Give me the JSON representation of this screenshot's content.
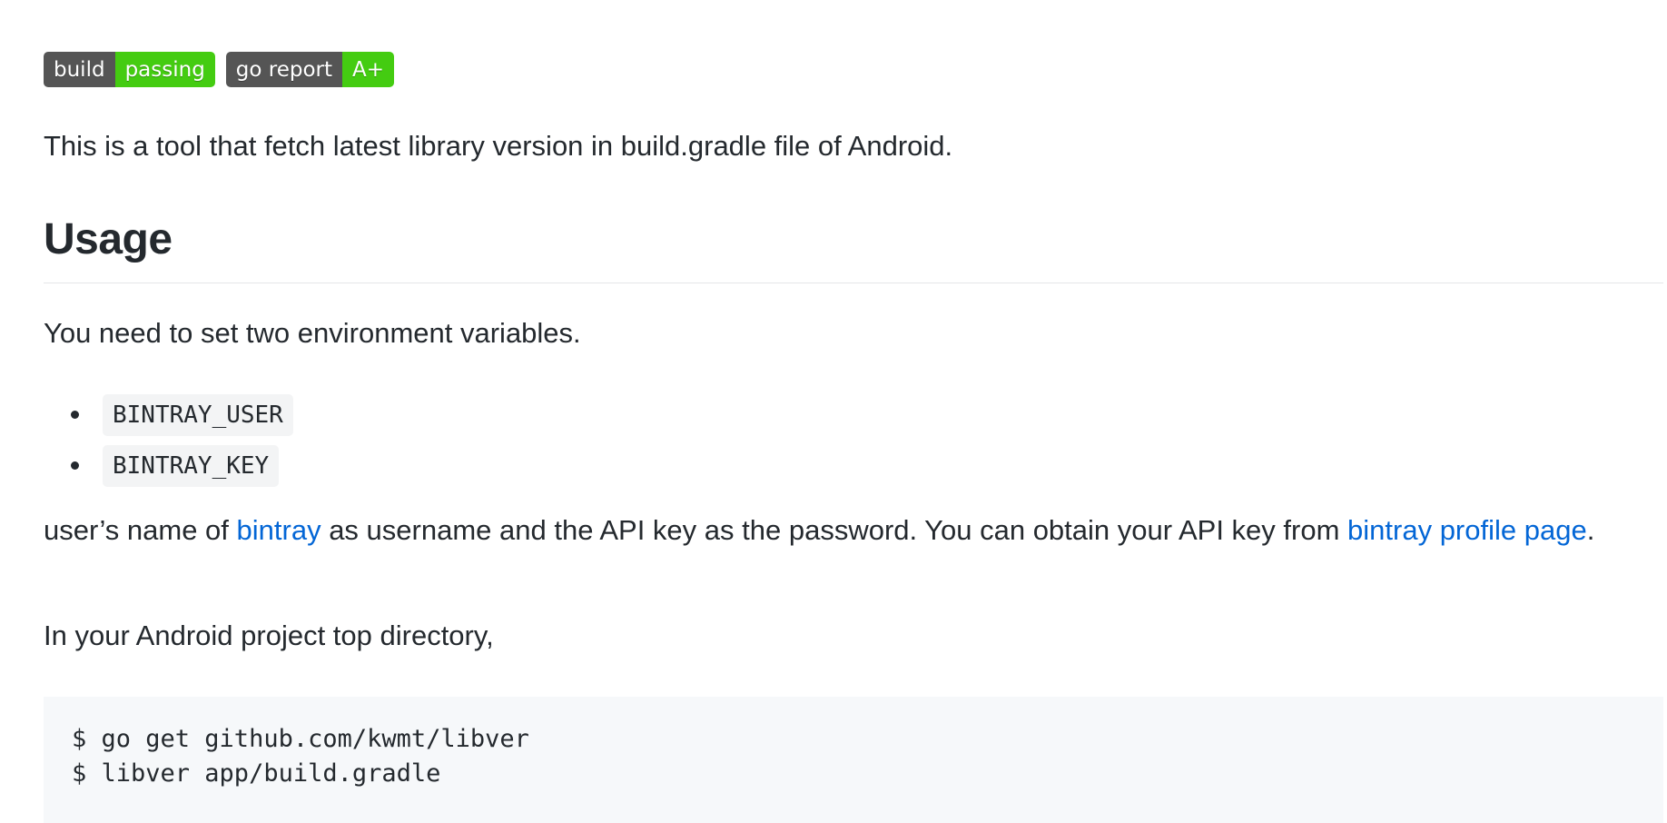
{
  "badges": [
    {
      "left": "build",
      "right": "passing",
      "color": "#44cc11"
    },
    {
      "left": "go report",
      "right": "A+",
      "color": "#44cc11"
    }
  ],
  "intro": "This is a tool that fetch latest library version in build.gradle file of Android.",
  "usage": {
    "heading": "Usage",
    "env_text": "You need to set two environment variables.",
    "env_vars": [
      "BINTRAY_USER",
      "BINTRAY_KEY"
    ],
    "user_text": {
      "part1": "user’s name of ",
      "link1": "bintray",
      "part2": " as username and the API key as the password. You can obtain your API key from ",
      "link2": "bintray profile page",
      "part3": "."
    },
    "android_text": "In your Android project top directory,",
    "code_lines": [
      "$ go get github.com/kwmt/libver",
      "$ libver app/build.gradle"
    ]
  },
  "colors": {
    "text": "#24292e",
    "link": "#0366d6",
    "badge_left": "#555555",
    "badge_right": "#44cc11",
    "code_bg": "#f6f8fa"
  }
}
